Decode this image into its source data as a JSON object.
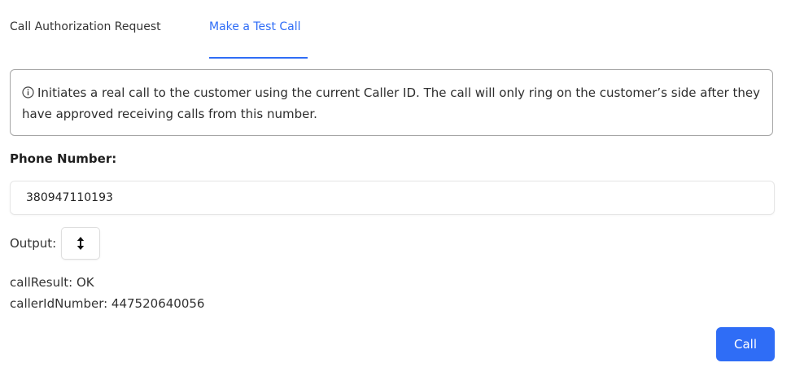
{
  "tabs": [
    {
      "label": "Call Authorization Request",
      "active": false
    },
    {
      "label": "Make a Test Call",
      "active": true
    }
  ],
  "info": {
    "icon": "info-circle-icon",
    "text": "Initiates a real call to the customer using the current Caller ID. The call will only ring on the customer’s side after they have approved receiving calls from this number."
  },
  "phone": {
    "label": "Phone Number:",
    "value": "380947110193"
  },
  "output": {
    "label": "Output:",
    "toggle_icon": "expand-collapse-icon",
    "lines": [
      "callResult: OK",
      "callerIdNumber: 447520640056"
    ]
  },
  "actions": {
    "call_label": "Call"
  },
  "colors": {
    "accent": "#2f6df6",
    "border": "#a6a6a6"
  }
}
